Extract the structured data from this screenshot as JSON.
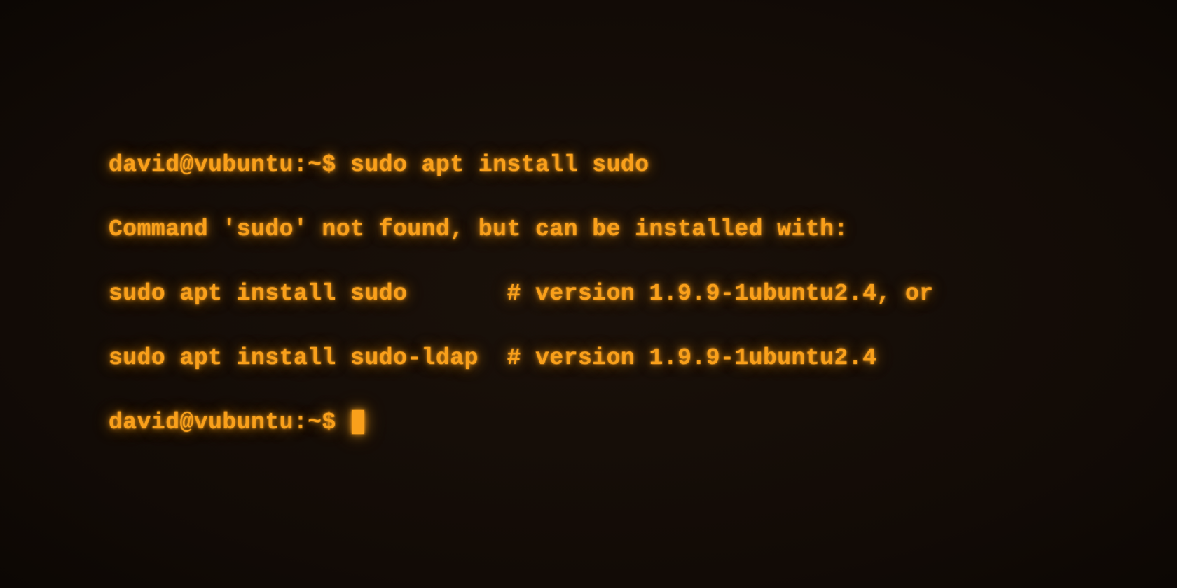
{
  "terminal": {
    "prompt1": "david@vubuntu:~$ ",
    "command1": "sudo apt install sudo",
    "out_line1": "Command 'sudo' not found, but can be installed with:",
    "out_line2": "sudo apt install sudo       # version 1.9.9-1ubuntu2.4, or",
    "out_line3": "sudo apt install sudo-ldap  # version 1.9.9-1ubuntu2.4",
    "prompt2": "david@vubuntu:~$ "
  },
  "colors": {
    "fg": "#f9a01b",
    "bg": "#140d08"
  }
}
